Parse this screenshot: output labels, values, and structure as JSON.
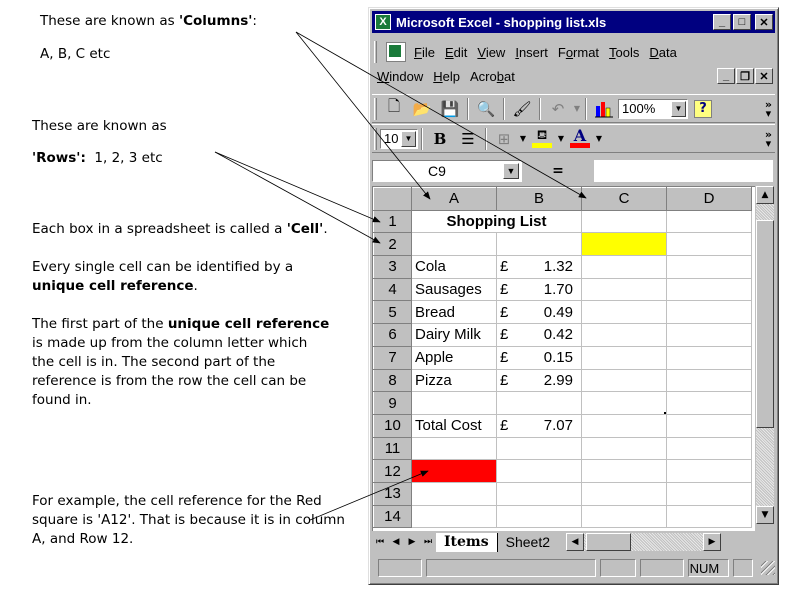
{
  "notes": {
    "columns_line1_prefix": "These are known as ",
    "columns_line1_bold": "'Columns'",
    "columns_line1_suffix": ":",
    "columns_line2": "A, B, C etc",
    "rows_line1": "These are known as",
    "rows_line2_bold": "'Rows':",
    "rows_line2_suffix": "  1, 2, 3 etc",
    "cell_p1_prefix": "Each box in a spreadsheet is called a ",
    "cell_p1_bold": "'Cell'",
    "cell_p1_suffix": ".",
    "cell_p2_prefix": "Every single cell can be identified by a ",
    "cell_p2_bold": "unique cell reference",
    "cell_p2_suffix": ".",
    "cell_p3_prefix": "The first part of the ",
    "cell_p3_bold": "unique cell reference",
    "cell_p3_suffix": " is made up from the column letter which the cell is in. The second part of the reference is from the row the cell can be found in.",
    "example": "For example, the cell reference for the Red square is 'A12'. That is because it is in column A, and Row 12."
  },
  "window": {
    "title": "Microsoft Excel - shopping list.xls",
    "minimize_glyph": "_",
    "maximize_glyph": "□",
    "close_glyph": "✕",
    "restore_glyph": "🗗"
  },
  "menu": {
    "items": [
      {
        "label": "File",
        "key": "F",
        "rest": "ile"
      },
      {
        "label": "Edit",
        "key": "E",
        "rest": "dit"
      },
      {
        "label": "View",
        "key": "V",
        "rest": "iew"
      },
      {
        "label": "Insert",
        "key": "I",
        "rest": "nsert"
      },
      {
        "label": "Format",
        "pre": "F",
        "key": "o",
        "rest": "rmat"
      },
      {
        "label": "Tools",
        "key": "T",
        "rest": "ools"
      },
      {
        "label": "Data",
        "key": "D",
        "rest": "ata"
      }
    ],
    "items_row2": [
      {
        "label": "Window",
        "key": "W",
        "rest": "indow"
      },
      {
        "label": "Help",
        "key": "H",
        "rest": "elp"
      },
      {
        "label": "Acrobat",
        "pre": "Acro",
        "key": "b",
        "rest": "at"
      }
    ]
  },
  "toolbar": {
    "zoom_value": "100%",
    "font_size": "10",
    "bold_label": "B",
    "font_color_label": "A",
    "fill_color": "#ffff00",
    "font_color": "#ff0000",
    "more_glyph": "»"
  },
  "formula_bar": {
    "name_box": "C9",
    "equals": "=",
    "formula": ""
  },
  "sheet": {
    "columns": [
      "A",
      "B",
      "C",
      "D"
    ],
    "active_column": "C",
    "active_row": "9",
    "rows": [
      {
        "num": "1",
        "a": "Shopping List",
        "currency": "",
        "value": ""
      },
      {
        "num": "2",
        "a": "",
        "currency": "",
        "value": ""
      },
      {
        "num": "3",
        "a": "Cola",
        "currency": "£",
        "value": "1.32"
      },
      {
        "num": "4",
        "a": "Sausages",
        "currency": "£",
        "value": "1.70"
      },
      {
        "num": "5",
        "a": "Bread",
        "currency": "£",
        "value": "0.49"
      },
      {
        "num": "6",
        "a": "Dairy Milk",
        "currency": "£",
        "value": "0.42"
      },
      {
        "num": "7",
        "a": "Apple",
        "currency": "£",
        "value": "0.15"
      },
      {
        "num": "8",
        "a": "Pizza",
        "currency": "£",
        "value": "2.99"
      },
      {
        "num": "9",
        "a": "",
        "currency": "",
        "value": ""
      },
      {
        "num": "10",
        "a": "Total Cost",
        "currency": "£",
        "value": "7.07"
      },
      {
        "num": "11",
        "a": "",
        "currency": "",
        "value": ""
      },
      {
        "num": "12",
        "a": "",
        "currency": "",
        "value": ""
      },
      {
        "num": "13",
        "a": "",
        "currency": "",
        "value": ""
      },
      {
        "num": "14",
        "a": "",
        "currency": "",
        "value": ""
      }
    ],
    "highlight_colors": {
      "C2": "#ffff00",
      "A12": "#ff0000"
    }
  },
  "tabs": [
    {
      "label": "Items",
      "active": true
    },
    {
      "label": "Sheet2",
      "active": false
    }
  ],
  "status": {
    "num_indicator": "NUM"
  }
}
